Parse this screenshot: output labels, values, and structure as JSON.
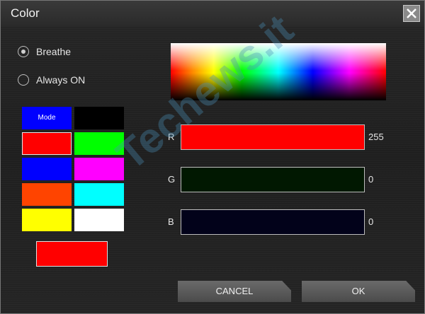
{
  "window": {
    "title": "Color"
  },
  "modes": {
    "options": [
      {
        "label": "Breathe",
        "selected": true
      },
      {
        "label": "Always ON",
        "selected": false
      }
    ]
  },
  "swatches": [
    {
      "color": "#0000ff",
      "label": "Mode"
    },
    {
      "color": "#000000"
    },
    {
      "color": "#ff0000",
      "selected": true
    },
    {
      "color": "#00ff00"
    },
    {
      "color": "#0000ff"
    },
    {
      "color": "#ff00ff"
    },
    {
      "color": "#ff4400"
    },
    {
      "color": "#00ffff"
    },
    {
      "color": "#ffff00"
    },
    {
      "color": "#ffffff"
    }
  ],
  "preview": {
    "color": "#ff0000"
  },
  "channels": [
    {
      "label": "R",
      "value": "255",
      "fill": "#ff0000"
    },
    {
      "label": "G",
      "value": "0",
      "fill": "#011801"
    },
    {
      "label": "B",
      "value": "0",
      "fill": "#02021a"
    }
  ],
  "buttons": {
    "cancel": "CANCEL",
    "ok": "OK"
  },
  "watermark": {
    "text": "Techews.it"
  }
}
